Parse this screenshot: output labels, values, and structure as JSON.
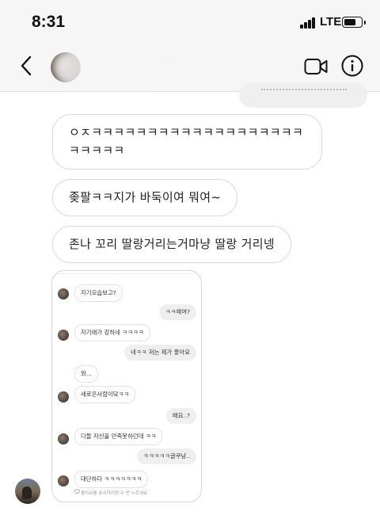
{
  "status_bar": {
    "time": "8:31",
    "network": "LTE"
  },
  "header": {
    "icons": {
      "back": "chevron-left-icon",
      "video": "video-camera-icon",
      "info": "info-circle-icon"
    }
  },
  "messages": [
    {
      "text": "ㅇㅈㅋㅋㅋㅋㅋㅋㅋㅋㅋㅋㅋㅋㅋㅋㅋㅋㅋㅋㅋㅋㅋㅋㅋㅋ"
    },
    {
      "text": "좆팔ㅋㅋ지가 바둑이여 뭐여~"
    },
    {
      "text": "존나 꼬리 딸랑거리는거마냥 딸랑 거리넹"
    }
  ],
  "embedded_screenshot": {
    "chat": [
      {
        "side": "in",
        "text": "자기모습보고?"
      },
      {
        "side": "out",
        "text": "ㅋㅋ왜여?"
      },
      {
        "side": "in",
        "text": "자기애가 강하네 ㅋㅋㅋㅋ"
      },
      {
        "side": "out",
        "text": "네ㅋㅋ 저는 제가 좋아요"
      },
      {
        "side": "in",
        "text": "와..."
      },
      {
        "side": "in",
        "text": "새로운사람이닼ㅋㅋ"
      },
      {
        "side": "out",
        "text": "왜요..?"
      },
      {
        "side": "in",
        "text": "다들 자신을 만족못하던데 ㅋㅋ"
      },
      {
        "side": "out",
        "text": "ㅋㅋㅋㅋㅋ글쿠낭.."
      },
      {
        "side": "in",
        "text": "대단하다 ㅋㅋㅋㅋㅋㅋㅋ"
      }
    ],
    "like_hint": "좋아요를 표시하려면 두 번 누르세요"
  },
  "colors": {
    "bubble_border": "#dbdbdb",
    "sent_bubble": "#efefef",
    "header_bg": "#f6f6f6"
  }
}
